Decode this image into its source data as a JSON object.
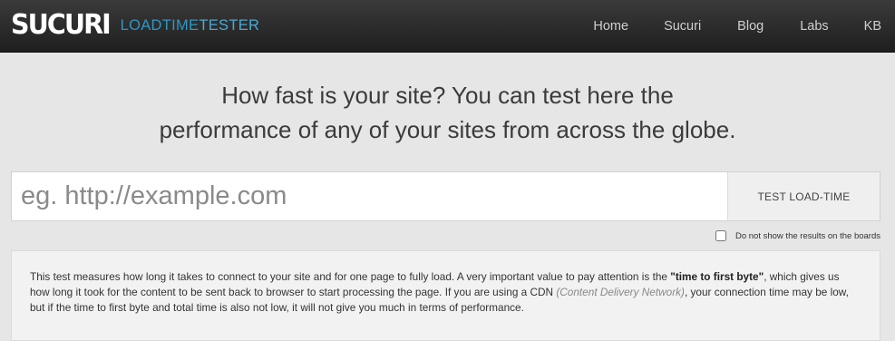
{
  "header": {
    "brand": "SUCURI",
    "product_a": "LOADTIME",
    "product_b": "TESTER",
    "nav": {
      "home": "Home",
      "sucuri": "Sucuri",
      "blog": "Blog",
      "labs": "Labs",
      "kb": "KB"
    }
  },
  "hero": {
    "line1": "How fast is your site? You can test here the",
    "line2": "performance of any of your sites from across the globe."
  },
  "search": {
    "placeholder": "eg. http://example.com",
    "value": "",
    "button_label": "TEST LOAD-TIME"
  },
  "options": {
    "hide_results_label": "Do not show the results on the boards",
    "hide_results_checked": false
  },
  "info": {
    "part1": "This test measures how long it takes to connect to your site and for one page to fully load. A very important value to pay attention is the ",
    "bold": "\"time to first byte\"",
    "part2": ", which gives us how long it took for the content to be sent back to browser to start processing the page. If you are using a CDN ",
    "italic": "(Content Delivery Network)",
    "part3": ", your connection time may be low, but if the time to first byte and total time is also not low, it will not give you much in terms of performance."
  }
}
